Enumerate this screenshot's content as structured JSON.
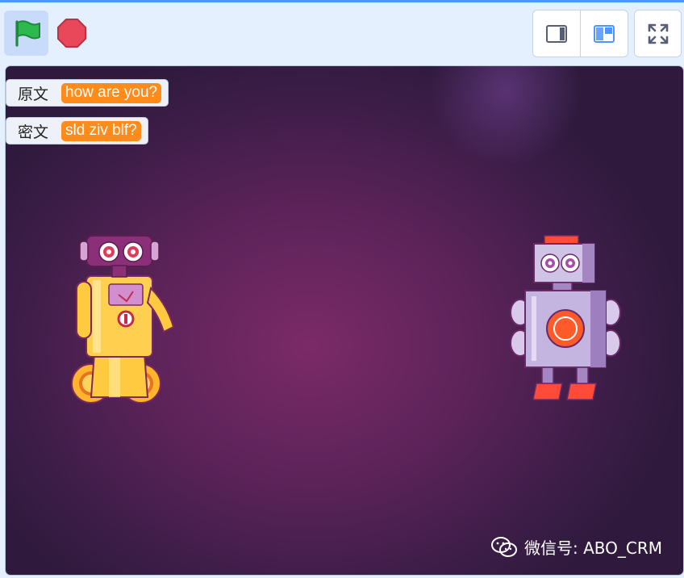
{
  "toolbar": {
    "green_flag_icon": "green-flag-icon",
    "stop_icon": "stop-icon",
    "small_stage_icon": "small-stage-layout-icon",
    "normal_stage_icon": "normal-stage-layout-icon",
    "fullscreen_icon": "fullscreen-icon"
  },
  "monitors": [
    {
      "label": "原文",
      "value": "how are you?"
    },
    {
      "label": "密文",
      "value": "sld ziv blf?"
    }
  ],
  "watermark": {
    "text": "微信号: ABO_CRM",
    "icon": "wechat-icon"
  },
  "sprites": [
    {
      "name": "yellow-robot"
    },
    {
      "name": "silver-robot"
    }
  ],
  "colors": {
    "accent": "#4c97ff",
    "monitor_value": "#ff8c1a",
    "flag": "#2db94d",
    "stop": "#e8485a"
  }
}
